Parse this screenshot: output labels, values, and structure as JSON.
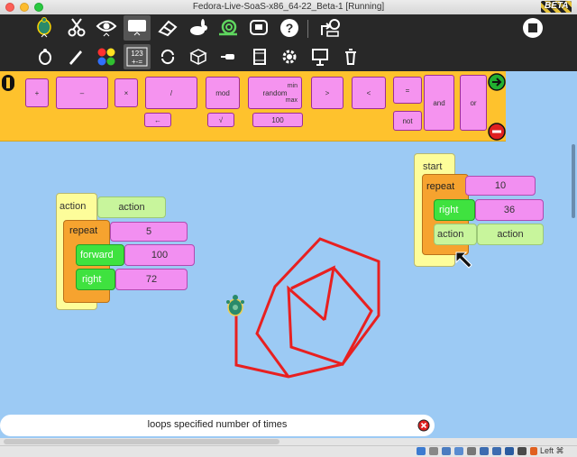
{
  "window": {
    "title": "Fedora-Live-SoaS-x86_64-22_Beta-1 [Running]",
    "badge": "BETA"
  },
  "palette": {
    "blocks": [
      {
        "label": "+"
      },
      {
        "label": "–"
      },
      {
        "label": "×"
      },
      {
        "label": "/"
      },
      {
        "label": "mod"
      },
      {
        "label": "random"
      },
      {
        "label": "min"
      },
      {
        "label": "max"
      },
      {
        "label": "100"
      },
      {
        "label": "←"
      },
      {
        "label": "√"
      },
      {
        "label": ">"
      },
      {
        "label": "<"
      },
      {
        "label": "="
      },
      {
        "label": "not"
      },
      {
        "label": "and"
      },
      {
        "label": "or"
      }
    ]
  },
  "stack1": {
    "hat": "action",
    "name": "action",
    "repeat": "repeat",
    "repeat_value": "5",
    "forward": "forward",
    "forward_value": "100",
    "right": "right",
    "right_value": "72"
  },
  "stack2": {
    "hat": "start",
    "repeat": "repeat",
    "repeat_value": "10",
    "right": "right",
    "right_value": "36",
    "action": "action",
    "action_name": "action"
  },
  "status": {
    "message": "loops specified number of times"
  },
  "host": {
    "key": "Left ⌘"
  },
  "colors": {
    "canvas": "#9ccaf4",
    "palette": "#fec22d",
    "pen": "#e82020"
  }
}
